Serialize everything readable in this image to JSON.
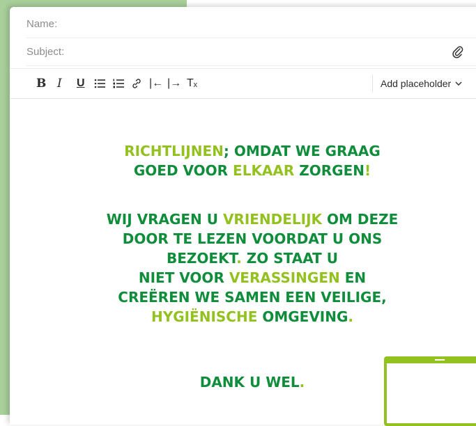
{
  "compose": {
    "name_label": "Name:",
    "subject_label": "Subject:"
  },
  "toolbar": {
    "bold": "B",
    "italic": "I",
    "underline": "U",
    "bullets": "☰",
    "numbers": "☷",
    "link": "⛓",
    "outdent": "|←",
    "indent": "|→",
    "clear": "Tₓ",
    "add_placeholder": "Add placeholder",
    "chevron": "⌄"
  },
  "poster": {
    "line1": [
      {
        "text": "RICHTLIJNEN",
        "lime": true
      },
      {
        "text": "; OMDAT WE GRAAG",
        "lime": false
      }
    ],
    "line2": [
      {
        "text": "GOED VOOR ",
        "lime": false
      },
      {
        "text": "ELKAAR",
        "lime": true
      },
      {
        "text": " ZORGEN",
        "lime": false
      },
      {
        "text": "!",
        "lime": true
      }
    ],
    "para2": [
      [
        {
          "text": "WIJ VRAGEN U ",
          "lime": false
        },
        {
          "text": "VRIENDELIJK",
          "lime": true
        },
        {
          "text": " OM DEZE",
          "lime": false
        }
      ],
      [
        {
          "text": "DOOR TE LEZEN VOORDAT U ONS",
          "lime": false
        }
      ],
      [
        {
          "text": "BEZOEKT",
          "lime": false
        },
        {
          "text": ".",
          "lime": true
        },
        {
          "text": " ZO STAAT U",
          "lime": false
        }
      ],
      [
        {
          "text": "NIET VOOR ",
          "lime": false
        },
        {
          "text": "VERASSINGEN",
          "lime": true
        },
        {
          "text": " EN",
          "lime": false
        }
      ],
      [
        {
          "text": "CREËREN WE SAMEN EEN VEILIGE,",
          "lime": false
        }
      ],
      [
        {
          "text": "HYGIËNISCHE",
          "lime": true
        },
        {
          "text": " OMGEVING",
          "lime": false
        },
        {
          "text": ".",
          "lime": true
        }
      ]
    ],
    "closing": [
      {
        "text": "DANK U WEL",
        "lime": false
      },
      {
        "text": ".",
        "lime": true
      }
    ]
  },
  "colors": {
    "green_dark": "#0f8d3b",
    "lime": "#93c11f",
    "background_green": "#a9cf9b"
  },
  "icons": {
    "attach": "paperclip-icon"
  }
}
